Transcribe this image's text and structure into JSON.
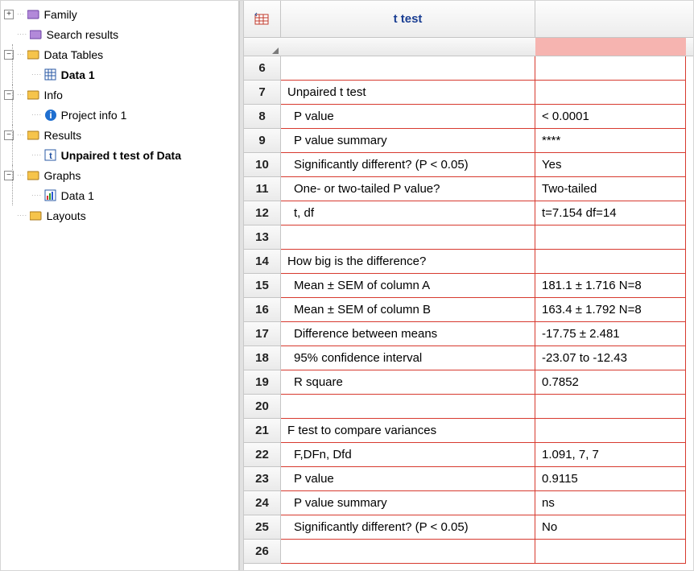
{
  "tree": {
    "family": "Family",
    "search_results": "Search results",
    "data_tables": "Data Tables",
    "data_1": "Data 1",
    "info": "Info",
    "project_info_1": "Project info 1",
    "results": "Results",
    "unpaired_t_test": "Unpaired t test of Data",
    "graphs": "Graphs",
    "graphs_data_1": "Data 1",
    "layouts": "Layouts",
    "toggle_plus": "+",
    "toggle_minus": "−"
  },
  "header": {
    "title": "t test"
  },
  "rows": [
    {
      "n": "6",
      "desc": "",
      "val": "",
      "indent": 0
    },
    {
      "n": "7",
      "desc": "Unpaired t test",
      "val": "",
      "indent": 0
    },
    {
      "n": "8",
      "desc": "P value",
      "val": "< 0.0001",
      "indent": 1
    },
    {
      "n": "9",
      "desc": "P value summary",
      "val": "****",
      "indent": 1
    },
    {
      "n": "10",
      "desc": "Significantly different? (P < 0.05)",
      "val": "Yes",
      "indent": 1
    },
    {
      "n": "11",
      "desc": "One- or two-tailed P value?",
      "val": "Two-tailed",
      "indent": 1
    },
    {
      "n": "12",
      "desc": "t, df",
      "val": "t=7.154 df=14",
      "indent": 1
    },
    {
      "n": "13",
      "desc": "",
      "val": "",
      "indent": 0
    },
    {
      "n": "14",
      "desc": "How big is the difference?",
      "val": "",
      "indent": 0
    },
    {
      "n": "15",
      "desc": "Mean ± SEM of column A",
      "val": "181.1 ± 1.716 N=8",
      "indent": 1
    },
    {
      "n": "16",
      "desc": "Mean ± SEM of column B",
      "val": "163.4 ± 1.792 N=8",
      "indent": 1
    },
    {
      "n": "17",
      "desc": "Difference between means",
      "val": "-17.75 ± 2.481",
      "indent": 1
    },
    {
      "n": "18",
      "desc": "95% confidence interval",
      "val": "-23.07 to -12.43",
      "indent": 1
    },
    {
      "n": "19",
      "desc": "R square",
      "val": "0.7852",
      "indent": 1
    },
    {
      "n": "20",
      "desc": "",
      "val": "",
      "indent": 0
    },
    {
      "n": "21",
      "desc": "F test to compare variances",
      "val": "",
      "indent": 0
    },
    {
      "n": "22",
      "desc": "F,DFn, Dfd",
      "val": "1.091, 7, 7",
      "indent": 1
    },
    {
      "n": "23",
      "desc": "P value",
      "val": "0.9115",
      "indent": 1
    },
    {
      "n": "24",
      "desc": "P value summary",
      "val": "ns",
      "indent": 1
    },
    {
      "n": "25",
      "desc": "Significantly different? (P < 0.05)",
      "val": "No",
      "indent": 1
    },
    {
      "n": "26",
      "desc": "",
      "val": "",
      "indent": 0
    }
  ]
}
